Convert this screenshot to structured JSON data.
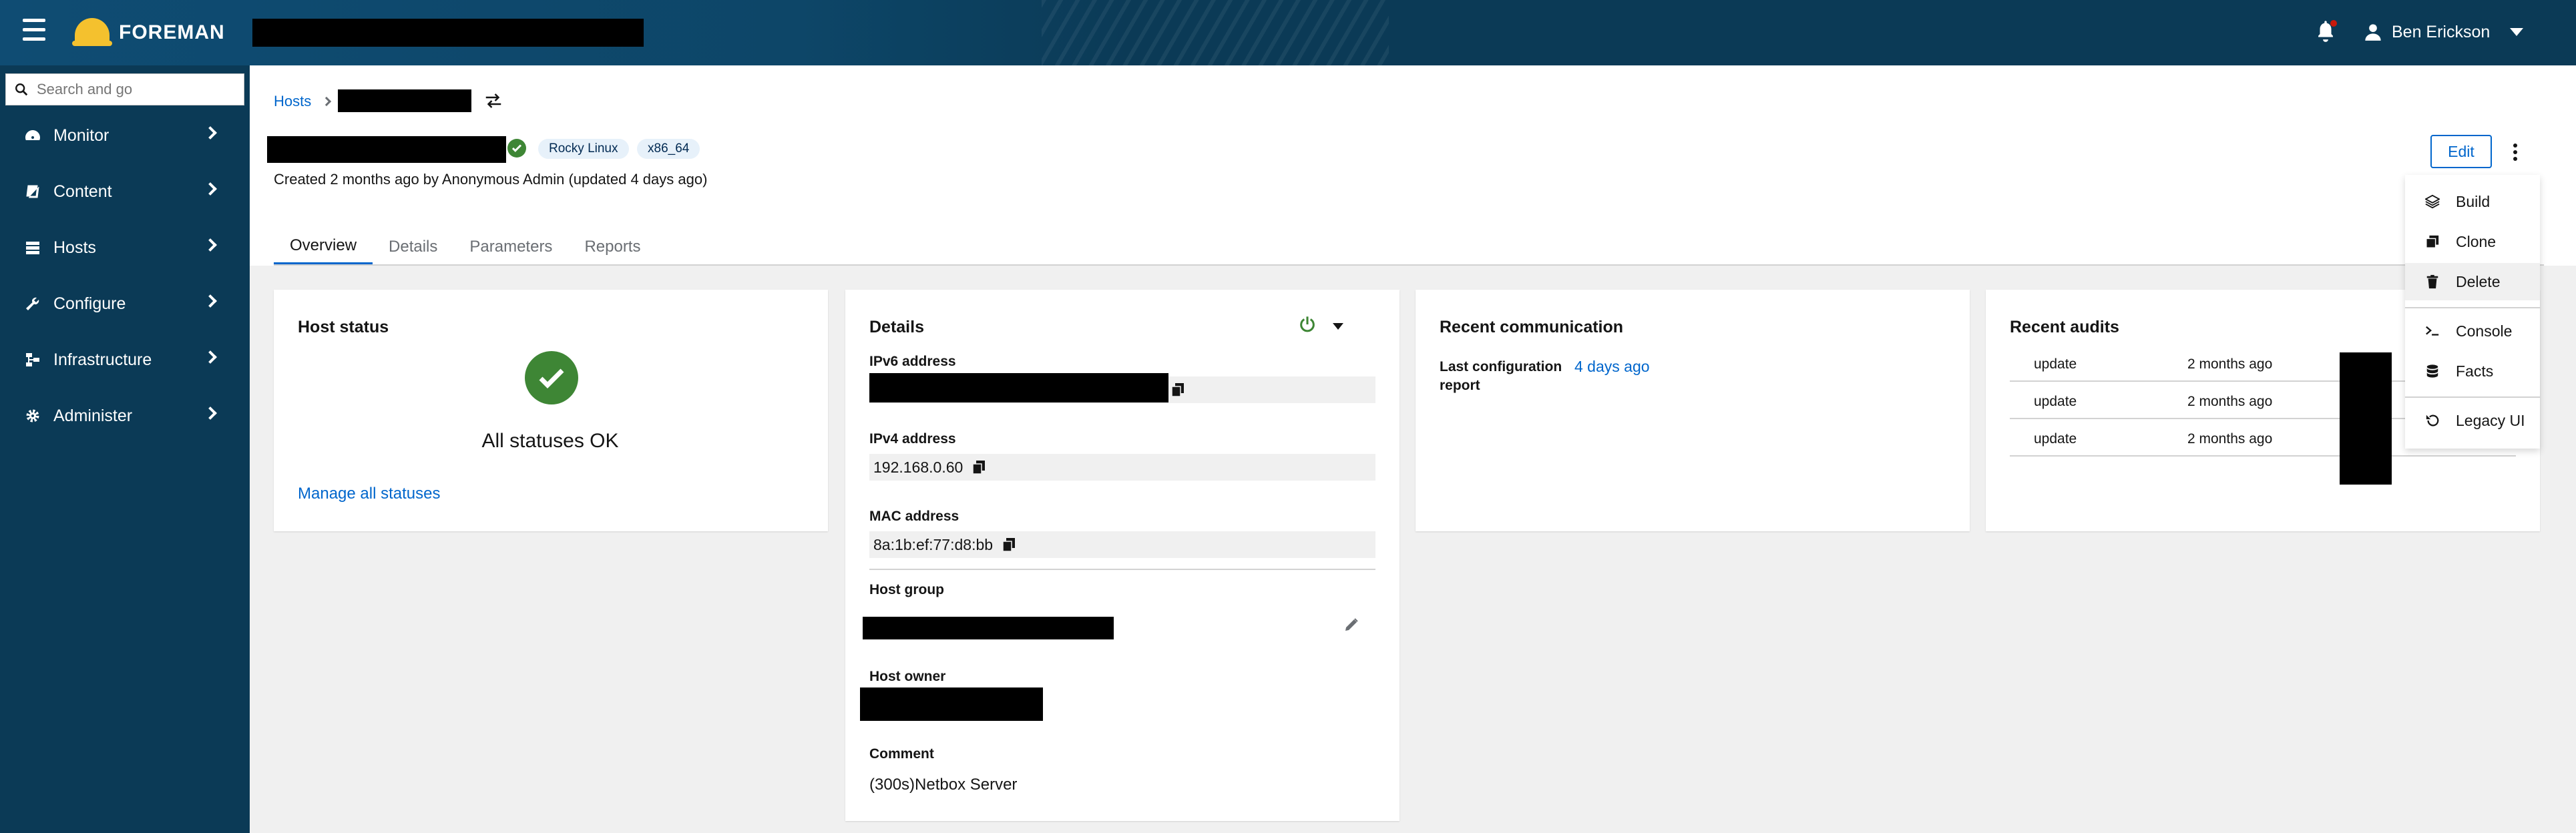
{
  "masthead": {
    "brand": "FOREMAN",
    "user_name": "Ben Erickson",
    "bell_icon": "bell-icon",
    "colors": {
      "masthead_bg": "#0b3a56",
      "accent": "#0066cc",
      "success": "#3e8635",
      "logo": "#f4c12e"
    }
  },
  "sidebar": {
    "search_placeholder": "Search and go",
    "items": [
      {
        "label": "Monitor",
        "icon": "dashboard-icon"
      },
      {
        "label": "Content",
        "icon": "book-icon"
      },
      {
        "label": "Hosts",
        "icon": "server-icon"
      },
      {
        "label": "Configure",
        "icon": "wrench-icon"
      },
      {
        "label": "Infrastructure",
        "icon": "network-icon"
      },
      {
        "label": "Administer",
        "icon": "cog-icon"
      }
    ]
  },
  "host": {
    "breadcrumb_root": "Hosts",
    "labels": [
      "Rocky Linux",
      "x86_64"
    ],
    "created_text": "Created 2 months ago by Anonymous Admin (updated 4 days ago)",
    "edit_label": "Edit",
    "tabs": [
      "Overview",
      "Details",
      "Parameters",
      "Reports"
    ],
    "active_tab": "Overview"
  },
  "host_status": {
    "title": "Host status",
    "summary": "All statuses OK",
    "manage_link": "Manage all statuses"
  },
  "details": {
    "title": "Details",
    "ipv6_label": "IPv6 address",
    "ipv4_label": "IPv4 address",
    "ipv4_value": "192.168.0.60",
    "mac_label": "MAC address",
    "mac_value": "8a:1b:ef:77:d8:bb",
    "hostgroup_label": "Host group",
    "owner_label": "Host owner",
    "comment_label": "Comment",
    "comment_value": "(300s)Netbox Server"
  },
  "recent_communication": {
    "title": "Recent communication",
    "label": "Last configuration report",
    "value": "4 days ago"
  },
  "recent_audits": {
    "title": "Recent audits",
    "rows": [
      {
        "action": "update",
        "time": "2 months ago"
      },
      {
        "action": "update",
        "time": "2 months ago"
      },
      {
        "action": "update",
        "time": "2 months ago"
      }
    ]
  },
  "dropdown": {
    "items": [
      {
        "label": "Build",
        "icon": "layers-icon"
      },
      {
        "label": "Clone",
        "icon": "clone-icon"
      },
      {
        "label": "Delete",
        "icon": "trash-icon"
      },
      {
        "label": "Console",
        "icon": "terminal-icon"
      },
      {
        "label": "Facts",
        "icon": "database-icon"
      },
      {
        "label": "Legacy UI",
        "icon": "undo-icon"
      }
    ],
    "hovered": "Delete"
  }
}
